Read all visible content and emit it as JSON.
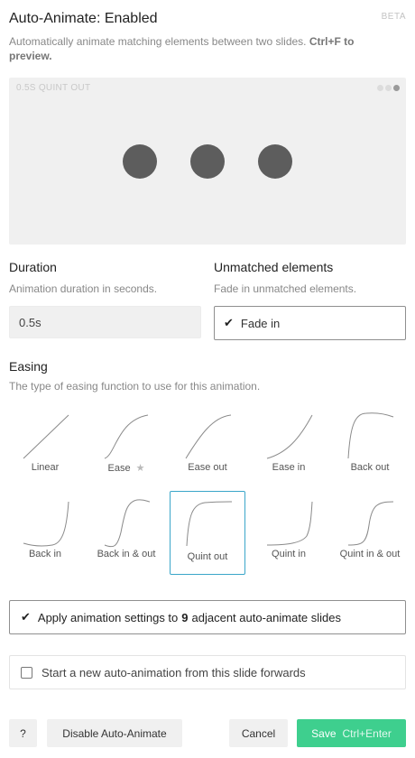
{
  "header": {
    "title": "Auto-Animate: Enabled",
    "beta": "BETA",
    "subtitle": "Automatically animate matching elements between two slides.",
    "shortcut": "Ctrl+F to preview."
  },
  "preview": {
    "label": "0.5S QUINT OUT",
    "step_count": 3,
    "active_step": 3,
    "ball_color": "#5d5d5d"
  },
  "duration": {
    "heading": "Duration",
    "description": "Animation duration in seconds.",
    "value": "0.5s"
  },
  "unmatched": {
    "heading": "Unmatched elements",
    "description": "Fade in unmatched elements.",
    "option_label": "Fade in",
    "checked": true
  },
  "easing": {
    "heading": "Easing",
    "description": "The type of easing function to use for this animation.",
    "selected": "Quint out",
    "options": [
      {
        "label": "Linear"
      },
      {
        "label": "Ease",
        "badge": "star-icon"
      },
      {
        "label": "Ease out"
      },
      {
        "label": "Ease in"
      },
      {
        "label": "Back out"
      },
      {
        "label": "Back in"
      },
      {
        "label": "Back in & out"
      },
      {
        "label": "Quint out"
      },
      {
        "label": "Quint in"
      },
      {
        "label": "Quint in & out"
      }
    ]
  },
  "apply_option": {
    "prefix": "Apply animation settings to",
    "count": "9",
    "suffix": "adjacent auto-animate slides",
    "checked": true
  },
  "start_option": {
    "label": "Start a new auto-animation from this slide forwards",
    "checked": false
  },
  "footer": {
    "help_label": "?",
    "disable_label": "Disable Auto-Animate",
    "cancel_label": "Cancel",
    "save_label": "Save",
    "save_shortcut": "Ctrl+Enter",
    "save_color": "#3ecf8e",
    "selection_color": "#3aa6c9"
  }
}
